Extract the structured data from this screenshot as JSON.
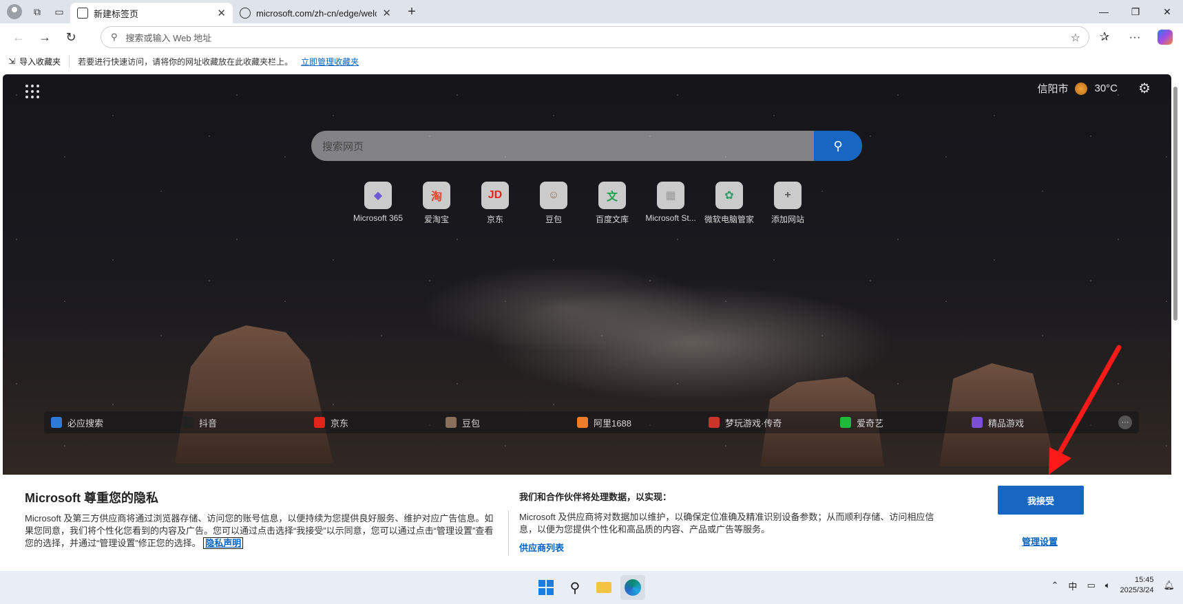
{
  "tabs": [
    {
      "title": "新建标签页",
      "active": true
    },
    {
      "title": "microsoft.com/zh-cn/edge/welcome",
      "active": false
    }
  ],
  "address": {
    "placeholder": "搜索或输入 Web 地址"
  },
  "favorites_bar": {
    "import_label": "导入收藏夹",
    "hint": "若要进行快速访问，请将你的网址收藏放在此收藏夹栏上。",
    "manage_link": "立即管理收藏夹"
  },
  "ntp": {
    "weather": {
      "city": "信阳市",
      "temp": "30°C"
    },
    "search_placeholder": "搜索网页",
    "tiles": [
      {
        "label": "Microsoft 365",
        "glyph": "◆",
        "color": "#6b5bd6"
      },
      {
        "label": "爱淘宝",
        "glyph": "淘",
        "color": "#e2452b"
      },
      {
        "label": "京东",
        "glyph": "JD",
        "color": "#e1251b"
      },
      {
        "label": "豆包",
        "glyph": "☺",
        "color": "#8a6f5a"
      },
      {
        "label": "百度文库",
        "glyph": "文",
        "color": "#1aa34a"
      },
      {
        "label": "Microsoft St...",
        "glyph": "▦",
        "color": "#9a9a9a"
      },
      {
        "label": "微软电脑管家",
        "glyph": "✿",
        "color": "#2f9c67"
      },
      {
        "label": "添加网站",
        "glyph": "+",
        "color": "#5a5a5a"
      }
    ],
    "bottom_links": [
      {
        "label": "必应搜索",
        "color": "#2a7ad6"
      },
      {
        "label": "抖音",
        "color": "#222222"
      },
      {
        "label": "京东",
        "color": "#e1251b"
      },
      {
        "label": "豆包",
        "color": "#8a6f5a"
      },
      {
        "label": "阿里1688",
        "color": "#f07c2a"
      },
      {
        "label": "梦玩游戏·传奇",
        "color": "#c9352b"
      },
      {
        "label": "爱奇艺",
        "color": "#1fba3a"
      },
      {
        "label": "精品游戏",
        "color": "#7b4fd6"
      }
    ],
    "more": "···"
  },
  "privacy": {
    "title": "Microsoft 尊重您的隐私",
    "body": "Microsoft 及第三方供应商将通过浏览器存储、访问您的账号信息，以便持续为您提供良好服务、维护对应广告信息。如果您同意，我们将个性化您看到的内容及广告。您可以通过点击选择“我接受”以示同意，您可以通过点击“管理设置”查看您的选择，并通过“管理设置”修正您的选择。",
    "privacy_link": "隐私声明",
    "subtitle": "我们和合作伙伴将处理数据，以实现：",
    "body2": "Microsoft 及供应商将对数据加以维护，以确保定位准确及精准识别设备参数；从而顺利存储、访问相应信息，以便为您提供个性化和高品质的内容、产品或广告等服务。",
    "vendors_link": "供应商列表",
    "accept": "我接受",
    "manage": "管理设置"
  },
  "taskbar": {
    "ime": "中",
    "time": "15:45",
    "date": "2025/3/24"
  },
  "colors": {
    "accent": "#1766c2",
    "annotation": "#ff1a1a"
  }
}
